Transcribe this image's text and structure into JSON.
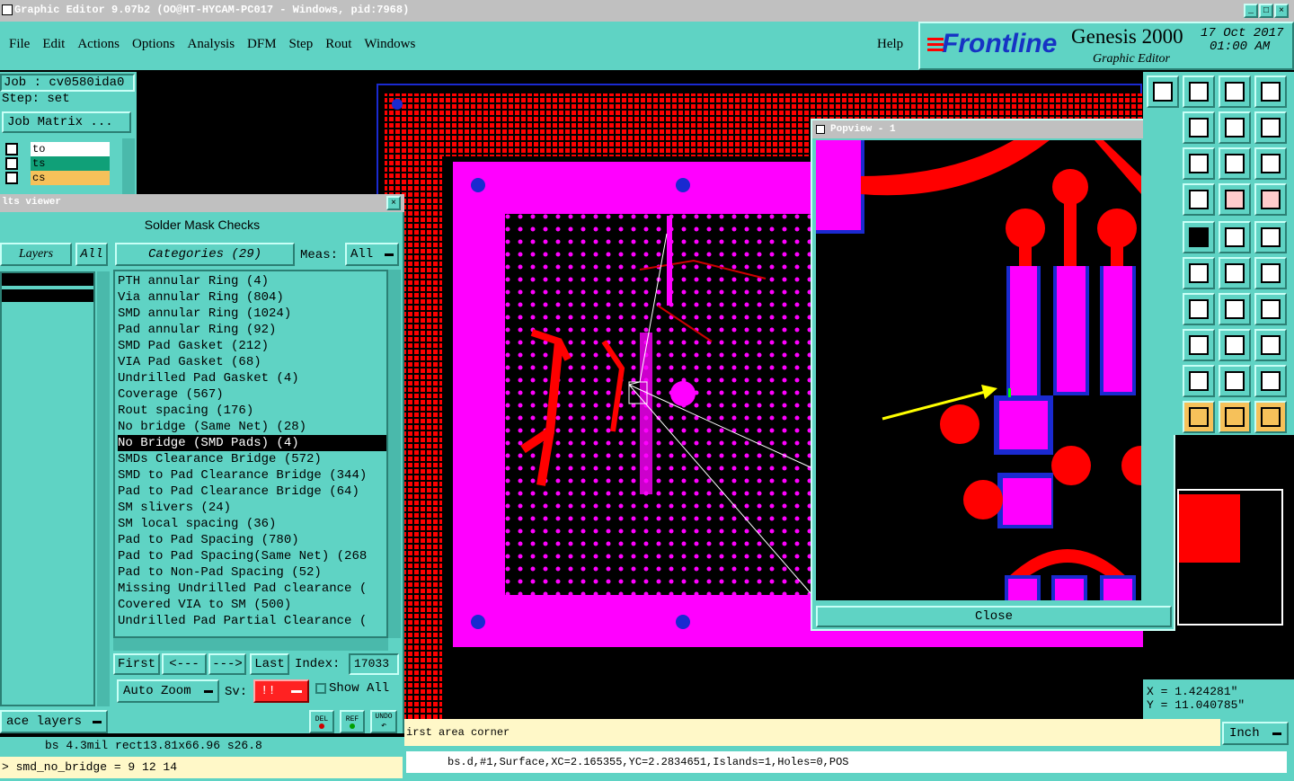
{
  "window": {
    "title": "Graphic Editor 9.07b2 (OO@HT-HYCAM-PC017 - Windows, pid:7968)"
  },
  "menu": [
    "File",
    "Edit",
    "Actions",
    "Options",
    "Analysis",
    "DFM",
    "Step",
    "Rout",
    "Windows"
  ],
  "help": "Help",
  "brand": {
    "logo": "Frontline",
    "product": "Genesis 2000",
    "subtitle": "Graphic Editor",
    "date": "17 Oct 2017",
    "time": "01:00 AM"
  },
  "job": {
    "job": "Job : cv0580ida0",
    "step": "Step: set",
    "matrix_btn": "Job Matrix ..."
  },
  "layers": [
    {
      "name": "to",
      "color": "#ffffff"
    },
    {
      "name": "ts",
      "color": "#10a078"
    },
    {
      "name": "cs",
      "color": "#f6c15a"
    }
  ],
  "results": {
    "title": "lts viewer",
    "panel_title": "Solder Mask Checks",
    "layers_btn": "Layers",
    "all_btn": "All",
    "categories_btn": "Categories (29)",
    "meas_label": "Meas:",
    "meas_value": "All",
    "items": [
      "PTH annular Ring (4)",
      "Via annular Ring (804)",
      "SMD annular Ring (1024)",
      "Pad annular Ring (92)",
      "SMD Pad Gasket (212)",
      "VIA Pad Gasket (68)",
      "Undrilled Pad Gasket (4)",
      "Coverage (567)",
      "Rout spacing (176)",
      "No bridge (Same Net) (28)",
      "No Bridge (SMD Pads) (4)",
      "SMDs Clearance Bridge (572)",
      "SMD to Pad Clearance Bridge (344)",
      "Pad to Pad Clearance Bridge (64)",
      "SM slivers (24)",
      "SM local spacing (36)",
      "Pad to Pad Spacing (780)",
      "Pad to Pad Spacing(Same Net) (268",
      "Pad to Non-Pad Spacing (52)",
      "Missing Undrilled Pad clearance (",
      "Covered VIA to SM (500)",
      "Undrilled Pad Partial Clearance ("
    ],
    "selected_index": 10,
    "first": "First",
    "prev": "<---",
    "next": "--->",
    "last": "Last",
    "index_label": "Index:",
    "index_value": "17033",
    "auto_zoom": "Auto Zoom",
    "sv_label": "Sv:",
    "sv_value": "!!",
    "show_all": "Show All",
    "del": "DEL",
    "ref": "REF",
    "undo": "UNDO",
    "face_layers": "ace layers"
  },
  "popview": {
    "title": "Popview - 1",
    "close": "Close"
  },
  "status": {
    "left_info": "bs 4.3mil   rect13.81x66.96   s26.8",
    "cmd": "> smd_no_bridge = 9 12 14",
    "prompt": "irst area corner",
    "feature": "bs.d,#1,Surface,XC=2.165355,YC=2.2834651,Islands=1,Holes=0,POS",
    "x": "X = 1.424281\"",
    "y": "Y = 11.040785\"",
    "units": "Inch"
  },
  "colors": {
    "teal": "#5fd3c4",
    "magenta": "#ff00ff",
    "red": "#ff0000",
    "blue": "#0020ff",
    "yellow": "#ffff00"
  }
}
